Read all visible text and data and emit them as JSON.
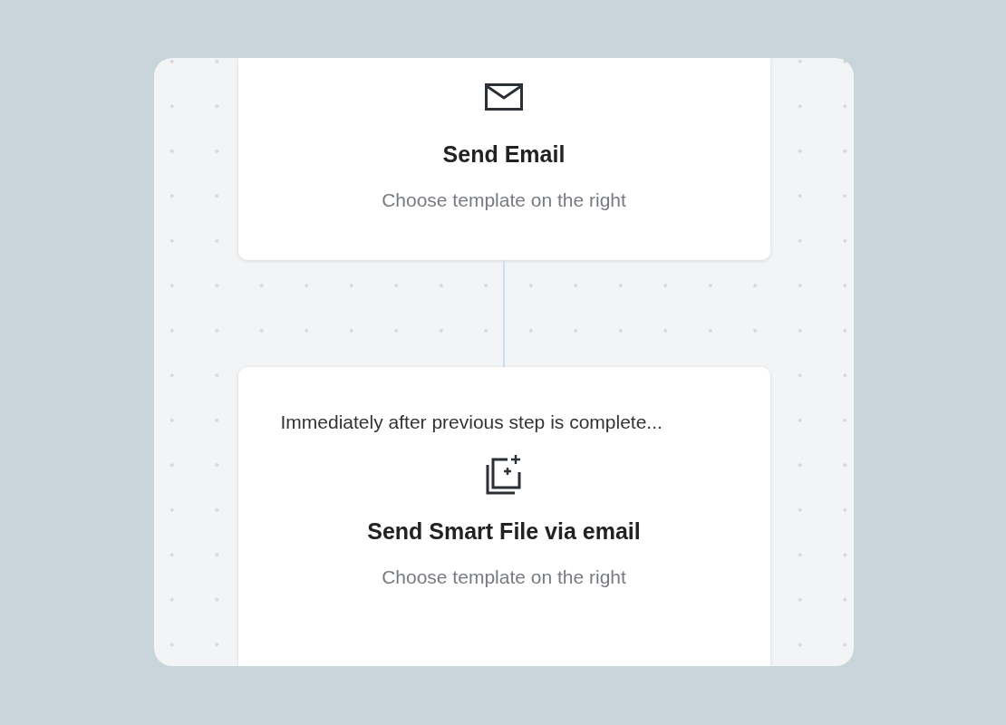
{
  "steps": [
    {
      "kind": "email",
      "title": "Send Email",
      "subtitle": "Choose template on the right"
    },
    {
      "kind": "smart_file",
      "timing": "Immediately after previous step is complete...",
      "title": "Send Smart File via email",
      "subtitle": "Choose template on the right"
    }
  ]
}
